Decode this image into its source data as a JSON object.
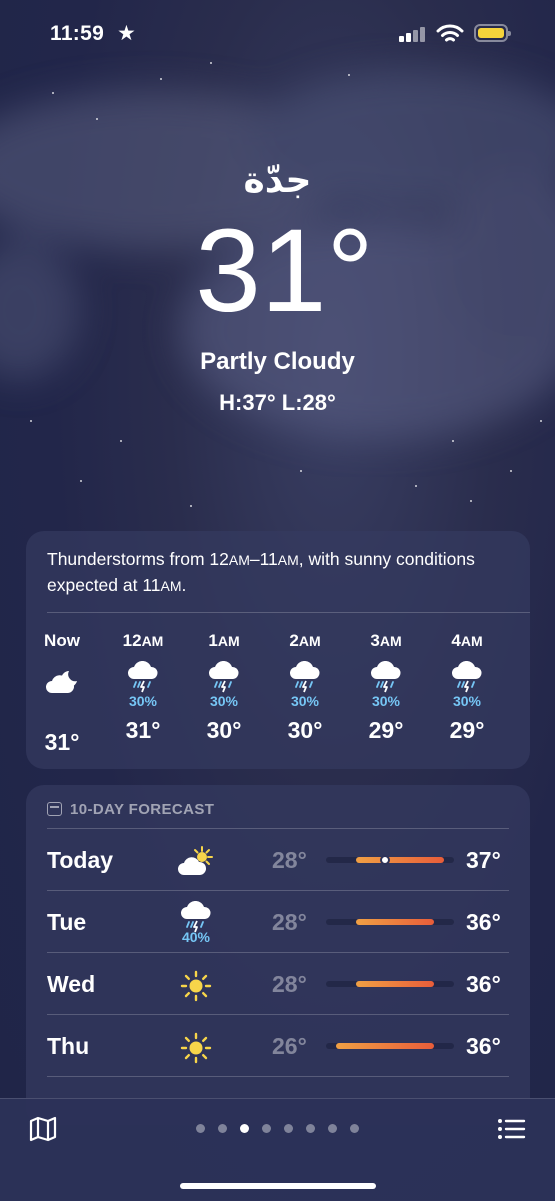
{
  "status": {
    "time": "11:59",
    "battery_color": "#f5d33b"
  },
  "location": {
    "city": "جدّة",
    "temperature": "31°",
    "condition": "Partly Cloudy",
    "high_low": "H:37°  L:28°"
  },
  "hourly": {
    "summary": "Thunderstorms from 12AM–11AM, with sunny conditions expected at 11AM.",
    "hours": [
      {
        "label": "Now",
        "icon": "moon-cloud-icon",
        "precip": "",
        "temp": "31°"
      },
      {
        "label": "12AM",
        "icon": "thunderstorm-icon",
        "precip": "30%",
        "temp": "31°"
      },
      {
        "label": "1AM",
        "icon": "thunderstorm-icon",
        "precip": "30%",
        "temp": "30°"
      },
      {
        "label": "2AM",
        "icon": "thunderstorm-icon",
        "precip": "30%",
        "temp": "30°"
      },
      {
        "label": "3AM",
        "icon": "thunderstorm-icon",
        "precip": "30%",
        "temp": "29°"
      },
      {
        "label": "4AM",
        "icon": "thunderstorm-icon",
        "precip": "30%",
        "temp": "29°"
      }
    ]
  },
  "forecast": {
    "title": "10-DAY FORECAST",
    "days": [
      {
        "day": "Today",
        "icon": "sun-cloud-icon",
        "precip": "",
        "low": "28°",
        "high": "37°",
        "low_value": 28,
        "high_value": 37,
        "current_value": 31
      },
      {
        "day": "Tue",
        "icon": "thunderstorm-icon",
        "precip": "40%",
        "low": "28°",
        "high": "36°",
        "low_value": 28,
        "high_value": 36
      },
      {
        "day": "Wed",
        "icon": "sun-icon",
        "precip": "",
        "low": "28°",
        "high": "36°",
        "low_value": 28,
        "high_value": 36
      },
      {
        "day": "Thu",
        "icon": "sun-icon",
        "precip": "",
        "low": "26°",
        "high": "36°",
        "low_value": 26,
        "high_value": 36
      }
    ],
    "range_min": 25,
    "range_max": 38
  },
  "pager": {
    "count": 8,
    "active_index": 2
  },
  "colors": {
    "precip": "#76c6f5",
    "bar_start": "#f0a044",
    "bar_end": "#e85d3a",
    "sun": "#f7d54a"
  }
}
